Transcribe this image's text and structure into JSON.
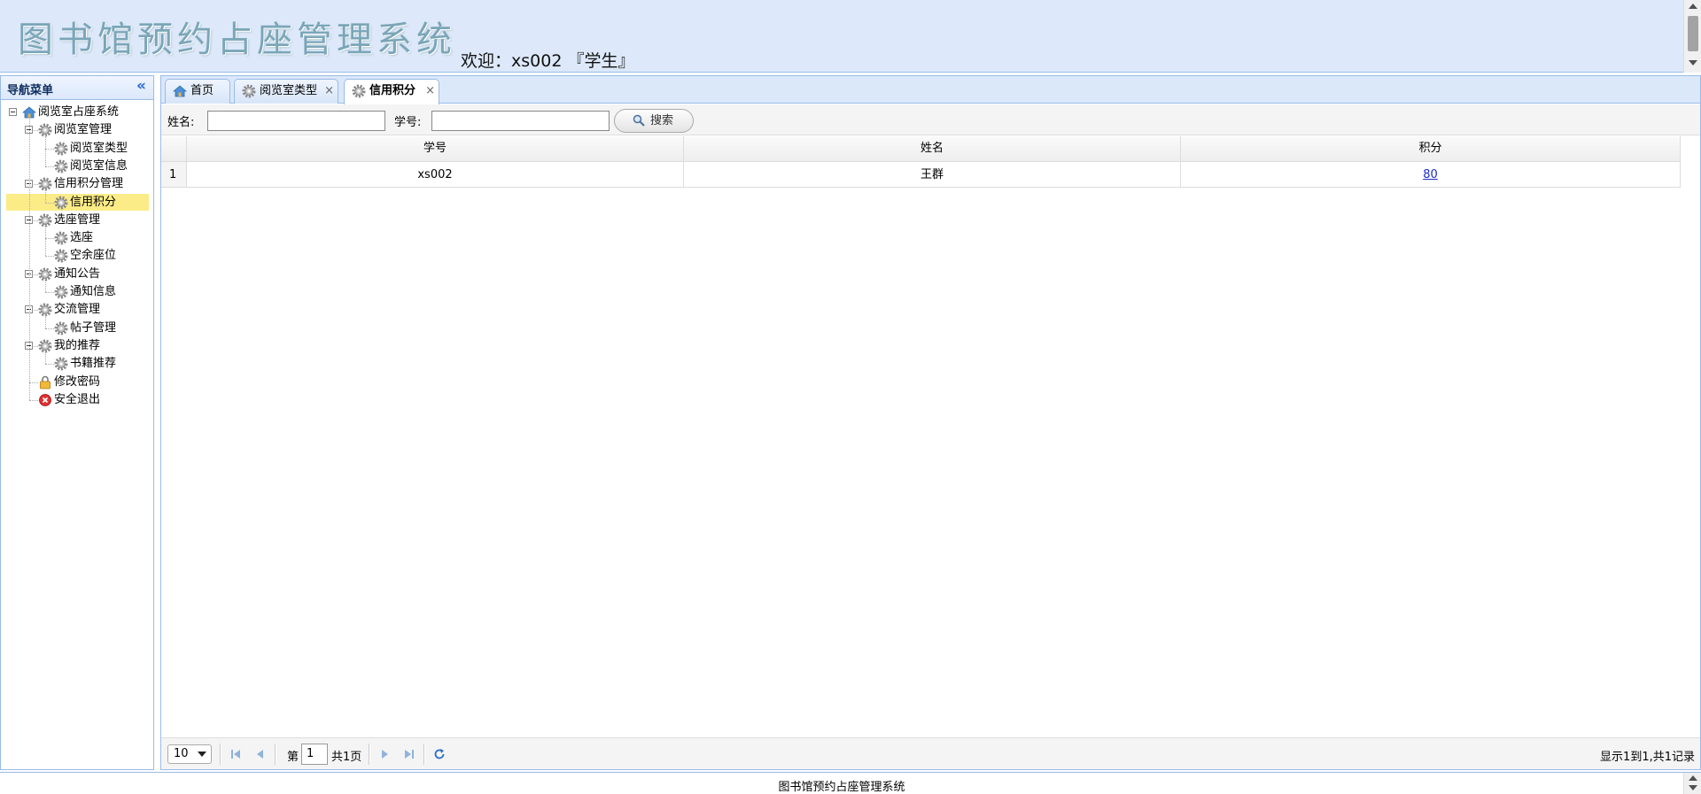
{
  "header": {
    "app_title": "图书馆预约占座管理系统",
    "welcome": "欢迎：xs002 『学生』"
  },
  "nav": {
    "title": "导航菜单",
    "collapse_glyph": "«",
    "tree": {
      "root": "阅览室占座系统",
      "groups": [
        {
          "label": "阅览室管理",
          "items": [
            "阅览室类型",
            "阅览室信息"
          ]
        },
        {
          "label": "信用积分管理",
          "items": [
            "信用积分"
          ]
        },
        {
          "label": "选座管理",
          "items": [
            "选座",
            "空余座位"
          ]
        },
        {
          "label": "通知公告",
          "items": [
            "通知信息"
          ]
        },
        {
          "label": "交流管理",
          "items": [
            "帖子管理"
          ]
        },
        {
          "label": "我的推荐",
          "items": [
            "书籍推荐"
          ]
        }
      ],
      "change_password": "修改密码",
      "logout": "安全退出",
      "selected": "信用积分"
    }
  },
  "tabs": [
    {
      "label": "首页",
      "icon": "home-icon",
      "closable": false,
      "active": false
    },
    {
      "label": "阅览室类型",
      "icon": "gear-icon",
      "closable": true,
      "active": false
    },
    {
      "label": "信用积分",
      "icon": "gear-icon",
      "closable": true,
      "active": true
    }
  ],
  "toolbar": {
    "name_label": "姓名:",
    "name_value": "",
    "student_id_label": "学号:",
    "student_id_value": "",
    "search_label": "搜索"
  },
  "grid": {
    "columns": [
      "学号",
      "姓名",
      "积分"
    ],
    "rows": [
      {
        "num": "1",
        "student_id": "xs002",
        "name": "王群",
        "score": "80"
      }
    ]
  },
  "pager": {
    "page_size": "10",
    "page_prefix": "第",
    "page_value": "1",
    "page_suffix": "共1页",
    "info": "显示1到1,共1记录"
  },
  "footer": {
    "text": "图书馆预约占座管理系统"
  },
  "colors": {
    "header_bg": "#dde9fa",
    "border": "#99bbe8",
    "selected_bg": "#fbec88",
    "link": "#1c2cc8"
  }
}
